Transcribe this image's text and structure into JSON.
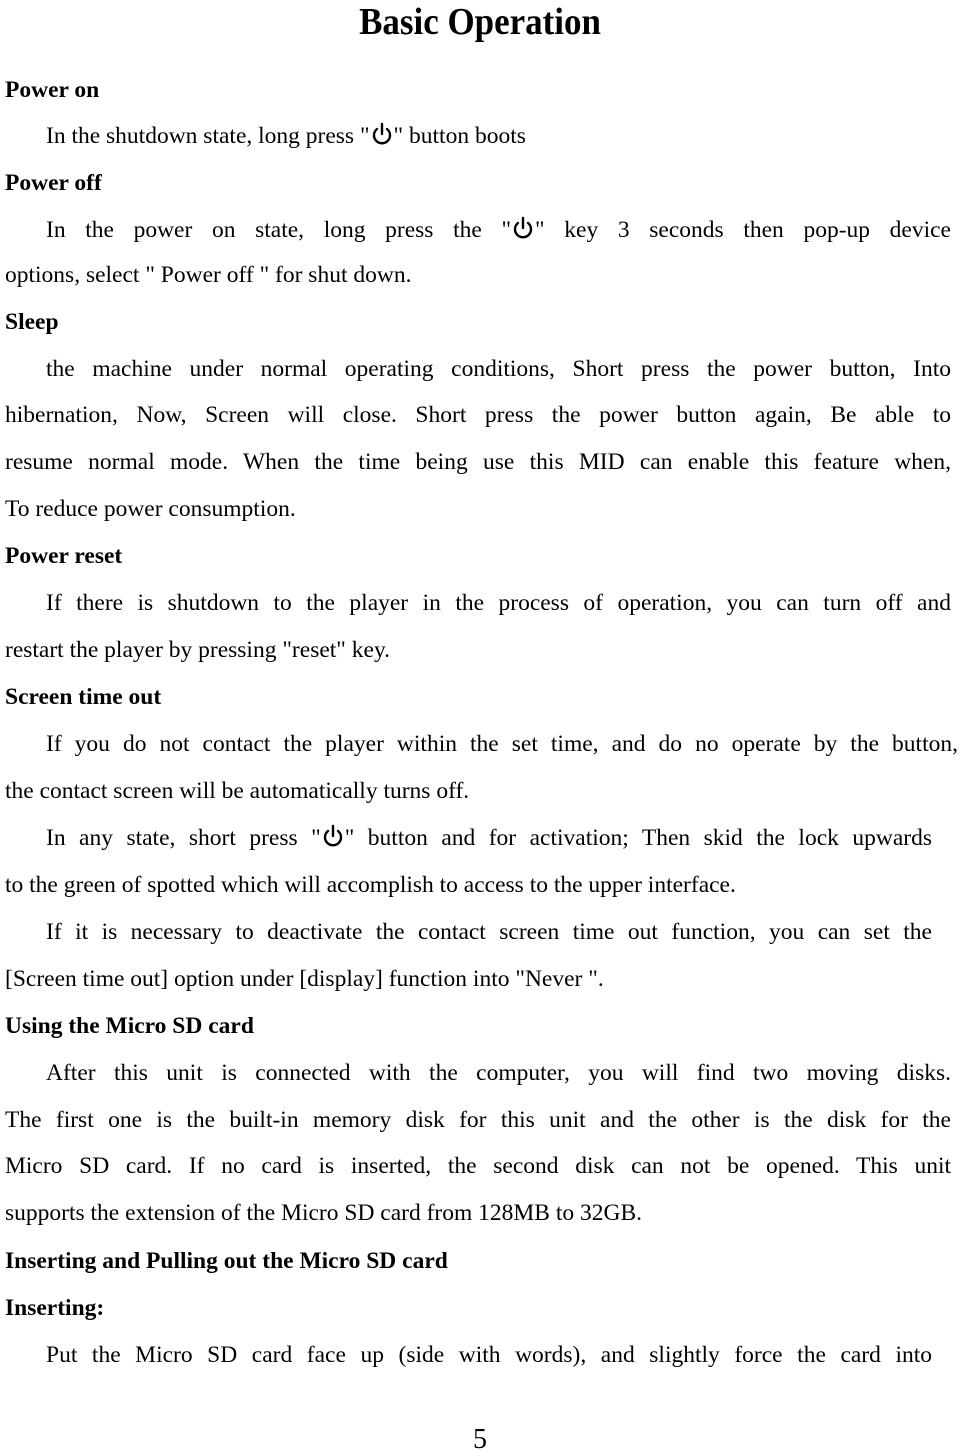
{
  "document": {
    "title": "Basic Operation",
    "page_number": "5",
    "sections": {
      "power_on": {
        "heading": "Power on",
        "p1_pre": "In the shutdown state, long press \"",
        "p1_icon": "power-icon",
        "p1_post": "\" button boots"
      },
      "power_off": {
        "heading": "Power off",
        "l1_pre": "In the power on state, long press the \"",
        "l1_icon": "power-icon",
        "l1_post": "\" key 3 seconds then pop-up device",
        "l2": "options, select \" Power off \" for shut down."
      },
      "sleep": {
        "heading": "Sleep",
        "lines": [
          "the machine under normal operating conditions, Short press the power button, Into",
          "hibernation, Now, Screen will close. Short press the power button again, Be able to",
          "resume normal mode. When the time being use this MID can enable this feature when,",
          "To reduce power consumption."
        ]
      },
      "power_reset": {
        "heading": "Power reset",
        "lines": [
          "If there is shutdown to the player in the process of operation, you can turn off and",
          "restart the player by pressing \"reset\" key."
        ]
      },
      "screen_time_out": {
        "heading": "Screen time out",
        "lines": [
          "If you do not contact the player within the set time, and do no operate by the button,",
          "the contact screen will be automatically turns off."
        ],
        "p2_l1_pre": "In any state, short press \"",
        "p2_icon": "power-icon",
        "p2_l1_post": "\" button and for activation; Then skid the lock upwards",
        "p2_l2": "to the green of spotted which will accomplish to access to the upper interface.",
        "p3_lines": [
          "If it is necessary to deactivate the contact screen time out function, you can set the",
          "[Screen time out] option under [display] function into \"Never \"."
        ]
      },
      "micro_sd": {
        "heading": "Using the Micro SD card",
        "lines": [
          "After this unit is connected with the computer, you will find two moving disks.",
          "The first one is the built-in memory disk for this unit and the other is the disk for the",
          "Micro SD card. If no card is inserted, the second disk can not be opened. This unit",
          "supports the extension of the Micro SD card from 128MB to 32GB."
        ]
      },
      "insert_pull": {
        "heading": "Inserting and Pulling out the Micro SD card"
      },
      "inserting": {
        "heading": "Inserting:",
        "lines": [
          "Put the Micro SD card face up (side with words), and slightly force the card into"
        ]
      }
    }
  }
}
